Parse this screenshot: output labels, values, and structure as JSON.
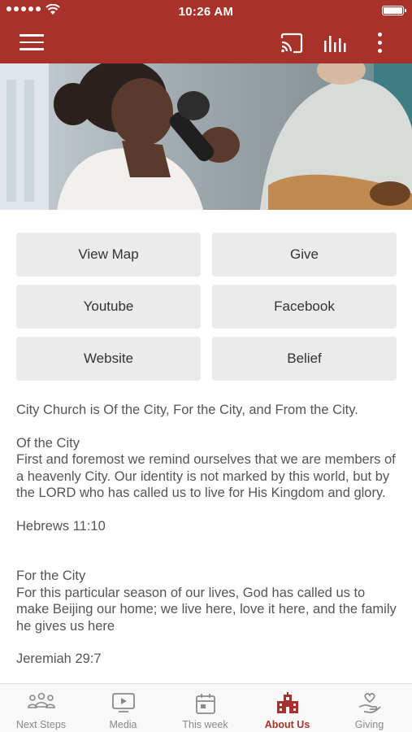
{
  "status_bar": {
    "time": "10:26 AM",
    "signal_bars": 5,
    "battery_level": 1.0
  },
  "app_bar": {
    "icons": [
      "menu-icon",
      "cast-icon",
      "audio-bars-icon",
      "more-vertical-icon"
    ]
  },
  "colors": {
    "brand": "#a8322a",
    "button_bg": "#ebebeb",
    "tabbar_bg": "#f8f8f8",
    "inactive_tab": "#8a8a8a"
  },
  "buttons": [
    {
      "label": "View Map"
    },
    {
      "label": "Give"
    },
    {
      "label": "Youtube"
    },
    {
      "label": "Facebook"
    },
    {
      "label": "Website"
    },
    {
      "label": "Belief"
    }
  ],
  "content": {
    "intro": "City Church is Of the City, For the City, and From the City.",
    "section1_title": "Of the City",
    "section1_body": "First and foremost we remind ourselves that we are members of a heavenly City. Our identity is not marked by this world, but by the LORD who has called us to live for His Kingdom and glory.",
    "section1_ref": "Hebrews 11:10",
    "section2_title": "For the City",
    "section2_body": "For this particular season of our lives, God has called us to make Beijing our home; we live here, love it here, and the family he gives us here",
    "section2_ref": "Jeremiah 29:7"
  },
  "tabbar": {
    "tabs": [
      {
        "label": "Next Steps",
        "icon": "people-icon",
        "active": false
      },
      {
        "label": "Media",
        "icon": "play-screen-icon",
        "active": false
      },
      {
        "label": "This week",
        "icon": "calendar-icon",
        "active": false
      },
      {
        "label": "About Us",
        "icon": "church-building-icon",
        "active": true
      },
      {
        "label": "Giving",
        "icon": "giving-hand-icon",
        "active": false
      }
    ]
  }
}
